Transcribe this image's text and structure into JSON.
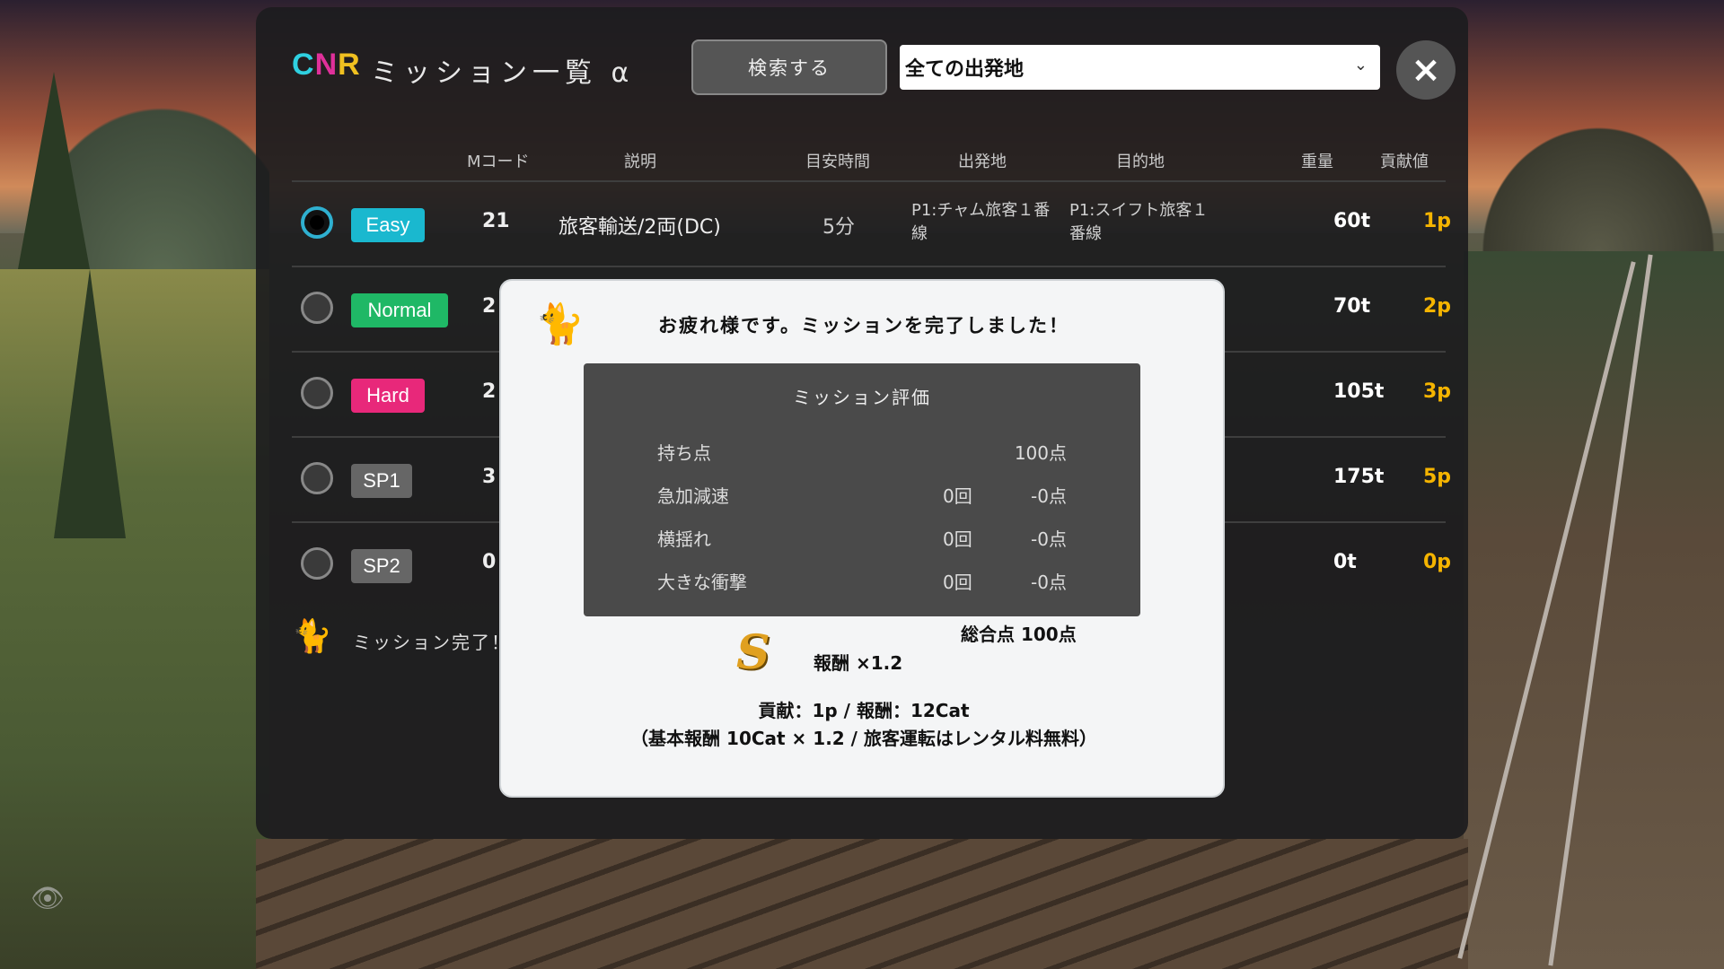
{
  "app": {
    "logo": {
      "c": "C",
      "n": "N",
      "r": "R"
    },
    "title": "ミッション一覧 α"
  },
  "toolbar": {
    "search_label": "検索する",
    "origin_select_value": "全ての出発地",
    "close_icon": "×"
  },
  "table": {
    "headers": [
      "Mコード",
      "説明",
      "目安時間",
      "出発地",
      "目的地",
      "重量",
      "貢献値"
    ],
    "rows": [
      {
        "difficulty": "Easy",
        "color": "#1ab8cf",
        "code": "21",
        "desc": "旅客輸送/2両(DC)",
        "time": "5分",
        "origin": "P1:チャム旅客１番線",
        "dest": "P1:スイフト旅客１番線",
        "weight": "60t",
        "points": "1p",
        "selected": true
      },
      {
        "difficulty": "Normal",
        "color": "#1fb866",
        "code": "2",
        "weight": "70t",
        "points": "2p",
        "selected": false
      },
      {
        "difficulty": "Hard",
        "color": "#e8287a",
        "code": "2",
        "weight": "105t",
        "points": "3p",
        "selected": false
      },
      {
        "difficulty": "SP1",
        "color": "#666666",
        "code": "3",
        "weight": "175t",
        "points": "5p",
        "selected": false
      },
      {
        "difficulty": "SP2",
        "color": "#666666",
        "code": "0",
        "weight": "0t",
        "points": "0p",
        "selected": false
      }
    ]
  },
  "footer": {
    "icon": "cat-icon",
    "text": "ミッション完了！"
  },
  "modal": {
    "icon": "cat-icon",
    "title": "お疲れ様です。ミッションを完了しました！",
    "eval": {
      "title": "ミッション評価",
      "rows": [
        {
          "label": "持ち点",
          "count": "",
          "points": "100点"
        },
        {
          "label": "急加減速",
          "count": "0回",
          "points": "-0点"
        },
        {
          "label": "横揺れ",
          "count": "0回",
          "points": "-0点"
        },
        {
          "label": "大きな衝撃",
          "count": "0回",
          "points": "-0点"
        }
      ]
    },
    "total": "総合点 100点",
    "grade": "S",
    "reward": "報酬 ×1.2",
    "summary_line1": "貢献：1p / 報酬：12Cat",
    "summary_line2": "（基本報酬 10Cat × 1.2 / 旅客運転はレンタル料無料）"
  },
  "colors": {
    "accent": "#2fd0e0",
    "points": "#f5b400"
  }
}
